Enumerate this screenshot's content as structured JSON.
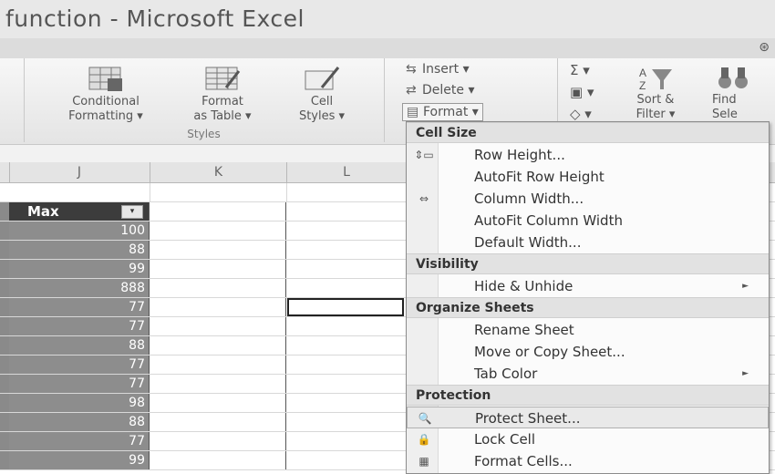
{
  "window": {
    "title": "function - Microsoft Excel"
  },
  "ribbon": {
    "styles_group": {
      "label": "Styles",
      "conditional": [
        "Conditional",
        "Formatting ▾"
      ],
      "format_table": [
        "Format",
        "as Table ▾"
      ],
      "cell_styles": [
        "Cell",
        "Styles ▾"
      ]
    },
    "cells_group": {
      "insert": "Insert ▾",
      "delete": "Delete ▾",
      "format": "Format ▾"
    },
    "editing_group": {
      "sigma": "Σ ▾",
      "sort": [
        "Sort &",
        "Filter ▾"
      ],
      "find": [
        "Find",
        "Sele"
      ]
    }
  },
  "columns": [
    "J",
    "K",
    "L"
  ],
  "table": {
    "header": "Max",
    "filter_glyph": "▾",
    "values": [
      "100",
      "88",
      "99",
      "888",
      "77",
      "77",
      "88",
      "77",
      "77",
      "98",
      "88",
      "77",
      "99"
    ]
  },
  "menu": {
    "sections": [
      {
        "title": "Cell Size",
        "items": [
          {
            "label": "Row Height...",
            "icon": "row-height-icon",
            "glyph": "⇕▭"
          },
          {
            "label": "AutoFit Row Height",
            "icon": "",
            "glyph": ""
          },
          {
            "label": "Column Width...",
            "icon": "column-width-icon",
            "glyph": "⇔"
          },
          {
            "label": "AutoFit Column Width",
            "icon": "",
            "glyph": ""
          },
          {
            "label": "Default Width...",
            "icon": "",
            "glyph": ""
          }
        ]
      },
      {
        "title": "Visibility",
        "items": [
          {
            "label": "Hide & Unhide",
            "icon": "",
            "glyph": "",
            "submenu": "►"
          }
        ]
      },
      {
        "title": "Organize Sheets",
        "items": [
          {
            "label": "Rename Sheet",
            "icon": "",
            "glyph": ""
          },
          {
            "label": "Move or Copy Sheet...",
            "icon": "",
            "glyph": ""
          },
          {
            "label": "Tab Color",
            "icon": "",
            "glyph": "",
            "submenu": "►"
          }
        ]
      },
      {
        "title": "Protection",
        "items": [
          {
            "label": "Protect Sheet...",
            "icon": "protect-sheet-icon",
            "glyph": "🔍"
          },
          {
            "label": "Lock Cell",
            "icon": "lock-icon",
            "glyph": "🔒"
          },
          {
            "label": "Format Cells...",
            "icon": "format-cells-icon",
            "glyph": "▦"
          }
        ]
      }
    ]
  }
}
